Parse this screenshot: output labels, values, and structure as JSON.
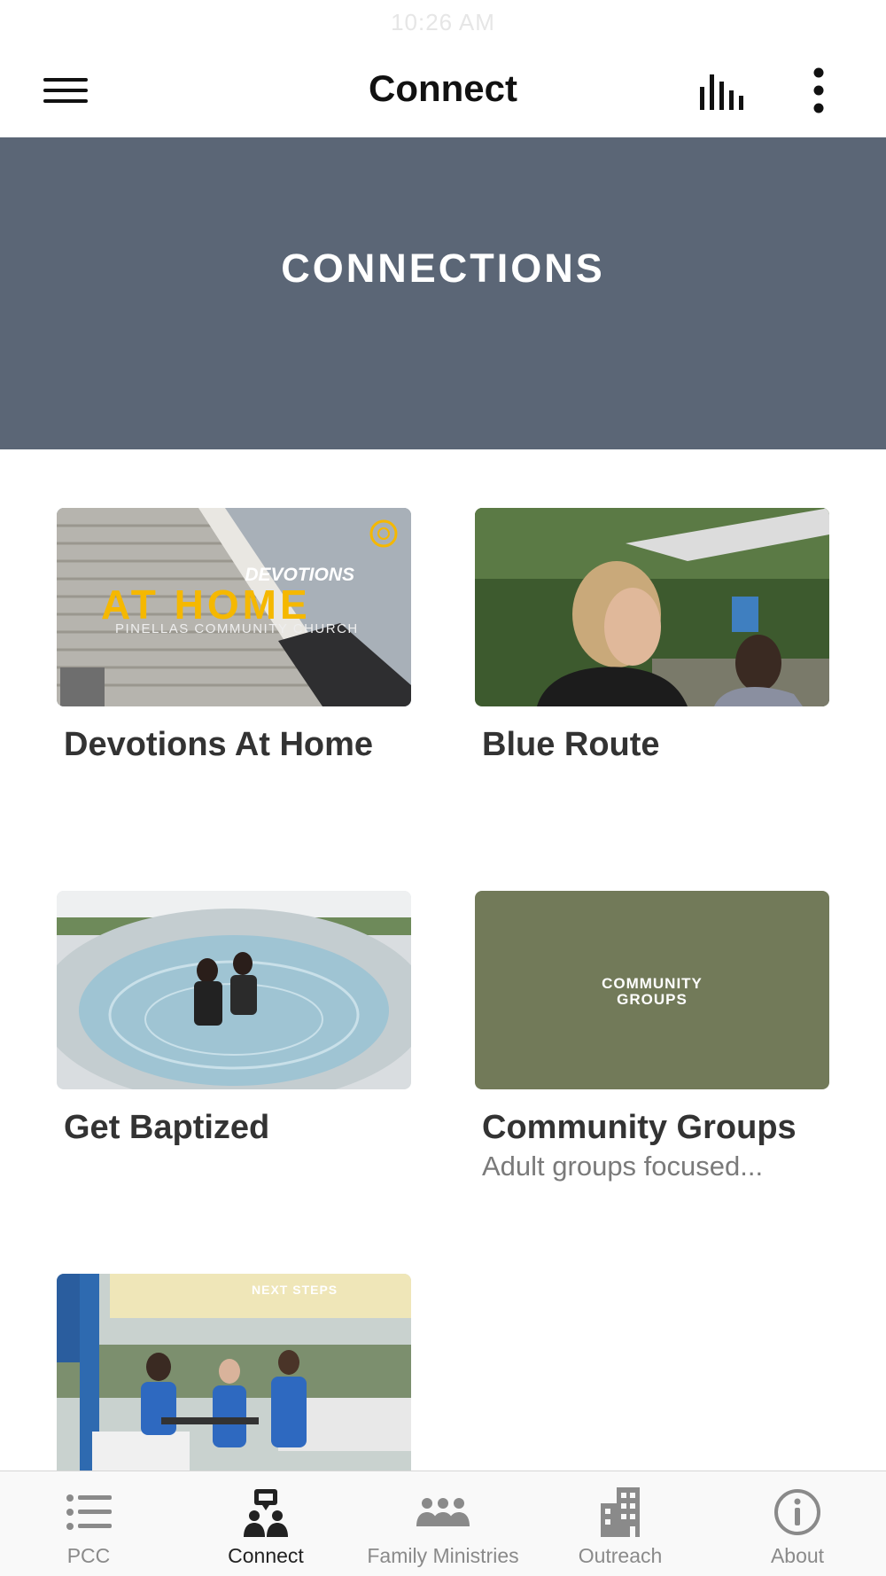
{
  "status_bar": {
    "time": "10:26 AM"
  },
  "header": {
    "title": "Connect",
    "menu_icon": "hamburger-menu-icon",
    "audio_icon": "audio-bars-icon",
    "more_icon": "more-vertical-icon"
  },
  "hero": {
    "title": "CONNECTIONS",
    "background": "#5b6676"
  },
  "cards": [
    {
      "title": "Devotions At Home",
      "image_text": {
        "line1": "DEVOTIONS",
        "line2": "AT HOME",
        "line3": "PINELLAS COMMUNITY CHURCH"
      }
    },
    {
      "title": "Blue Route"
    },
    {
      "title": "Get Baptized"
    },
    {
      "title": "Community Groups",
      "subtitle": "Adult groups focused...",
      "image_text": {
        "line1": "COMMUNITY",
        "line2": "GROUPS"
      }
    },
    {
      "title": "",
      "image_text": {
        "line1": "NEXT STEPS"
      }
    }
  ],
  "tabs": [
    {
      "label": "PCC",
      "icon": "list-icon",
      "active": false
    },
    {
      "label": "Connect",
      "icon": "connect-people-icon",
      "active": true
    },
    {
      "label": "Family Ministries",
      "icon": "family-group-icon",
      "active": false
    },
    {
      "label": "Outreach",
      "icon": "building-icon",
      "active": false
    },
    {
      "label": "About",
      "icon": "info-icon",
      "active": false
    }
  ],
  "colors": {
    "accent_yellow": "#f5b800",
    "community_green": "#727a59",
    "tab_inactive": "#8a8a8a",
    "tab_active": "#222222"
  }
}
